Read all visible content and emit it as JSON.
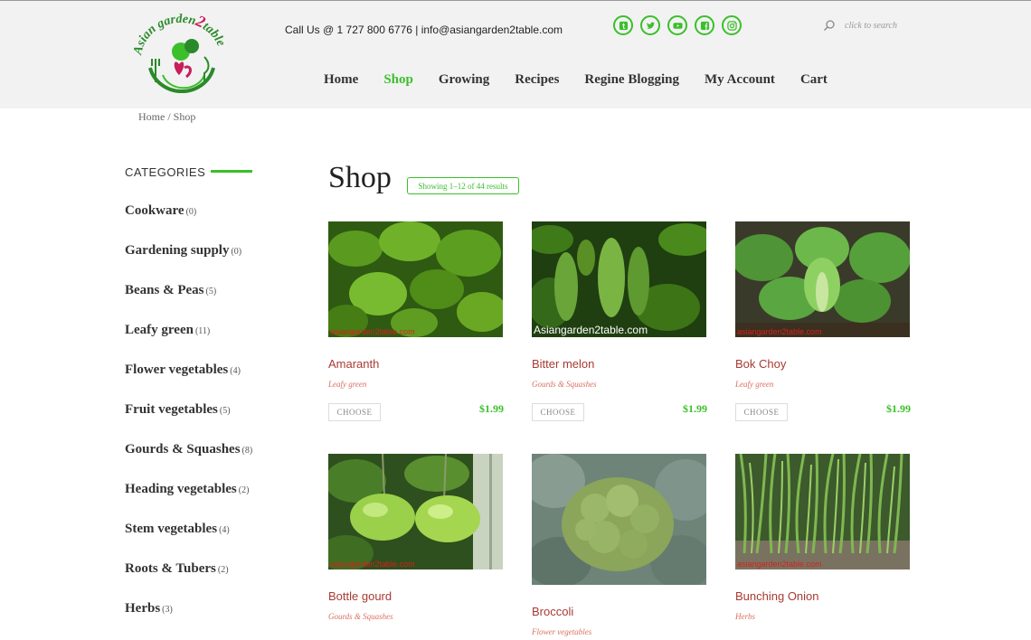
{
  "header": {
    "contact": "Call Us @ 1 727 800 6776 | info@asiangarden2table.com",
    "search_placeholder": "click to search"
  },
  "logo": {
    "line1": "Asian garden",
    "numeral": "2",
    "line2": "table"
  },
  "nav": {
    "home": "Home",
    "shop": "Shop",
    "growing": "Growing",
    "recipes": "Recipes",
    "blogging": "Regine Blogging",
    "account": "My Account",
    "cart": "Cart"
  },
  "breadcrumb": {
    "home": "Home",
    "separator": " / ",
    "current": "Shop"
  },
  "sidebar": {
    "title": "CATEGORIES",
    "categories": [
      {
        "name": "Cookware",
        "count": "(0)"
      },
      {
        "name": "Gardening supply",
        "count": "(0)"
      },
      {
        "name": "Beans & Peas",
        "count": "(5)"
      },
      {
        "name": "Leafy green",
        "count": "(11)"
      },
      {
        "name": "Flower vegetables",
        "count": "(4)"
      },
      {
        "name": "Fruit vegetables",
        "count": "(5)"
      },
      {
        "name": "Gourds & Squashes",
        "count": "(8)"
      },
      {
        "name": "Heading vegetables",
        "count": "(2)"
      },
      {
        "name": "Stem vegetables",
        "count": "(4)"
      },
      {
        "name": "Roots & Tubers",
        "count": "(2)"
      },
      {
        "name": "Herbs",
        "count": "(3)"
      }
    ]
  },
  "main": {
    "title": "Shop",
    "result_count": "Showing 1–12 of 44 results",
    "products": [
      {
        "name": "Amaranth",
        "category": "Leafy green",
        "price": "$1.99",
        "button": "CHOOSE",
        "watermark": "asiangarden2table.com"
      },
      {
        "name": "Bitter melon",
        "category": "Gourds & Squashes",
        "price": "$1.99",
        "button": "CHOOSE",
        "watermark": "Asiangarden2table.com"
      },
      {
        "name": "Bok Choy",
        "category": "Leafy green",
        "price": "$1.99",
        "button": "CHOOSE",
        "watermark": "asiangarden2table.com"
      },
      {
        "name": "Bottle gourd",
        "category": "Gourds & Squashes",
        "watermark": "asiangarden2table.com"
      },
      {
        "name": "Broccoli",
        "category": "Flower vegetables"
      },
      {
        "name": "Bunching Onion",
        "category": "Herbs",
        "watermark": "asiangarden2table.com"
      }
    ]
  },
  "colors": {
    "accent": "#3bbf2a",
    "product_name": "#a83a32",
    "product_category": "#d97060",
    "header_bg": "#f2f2f2"
  },
  "icons": [
    "search-icon",
    "tumblr-icon",
    "twitter-icon",
    "youtube-icon",
    "facebook-icon",
    "instagram-icon"
  ]
}
